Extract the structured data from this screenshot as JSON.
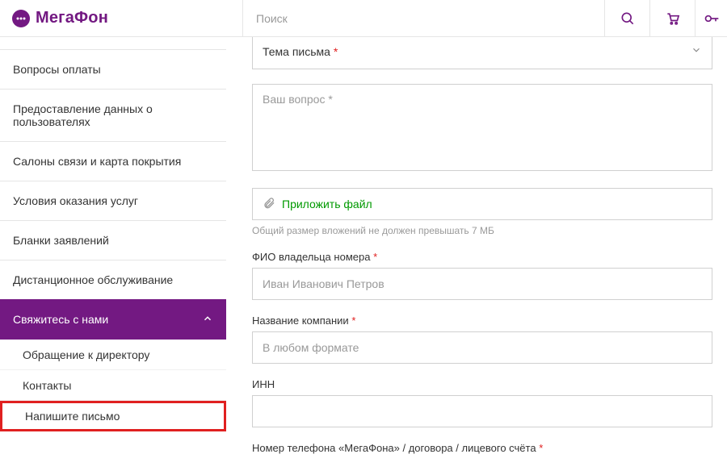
{
  "header": {
    "logo_text": "МегаФон",
    "search_placeholder": "Поиск"
  },
  "sidebar": {
    "items": [
      {
        "label": "Вопросы оплаты"
      },
      {
        "label": "Предоставление данных о пользователях"
      },
      {
        "label": "Салоны связи и карта покрытия"
      },
      {
        "label": "Условия оказания услуг"
      },
      {
        "label": "Бланки заявлений"
      },
      {
        "label": "Дистанционное обслуживание"
      }
    ],
    "active_label": "Свяжитесь с нами",
    "sub": [
      {
        "label": "Обращение к директору"
      },
      {
        "label": "Контакты"
      },
      {
        "label": "Напишите письмо"
      }
    ]
  },
  "form": {
    "subject_label": "Тема письма",
    "question_placeholder": "Ваш вопрос *",
    "attach_label": "Приложить файл",
    "attach_helper": "Общий размер вложений не должен превышать 7 МБ",
    "fio_label": "ФИО владельца номера",
    "fio_placeholder": "Иван Иванович Петров",
    "company_label": "Название компании",
    "company_placeholder": "В любом формате",
    "inn_label": "ИНН",
    "phone_label": "Номер телефона «МегаФона» / договора / лицевого счёта"
  }
}
